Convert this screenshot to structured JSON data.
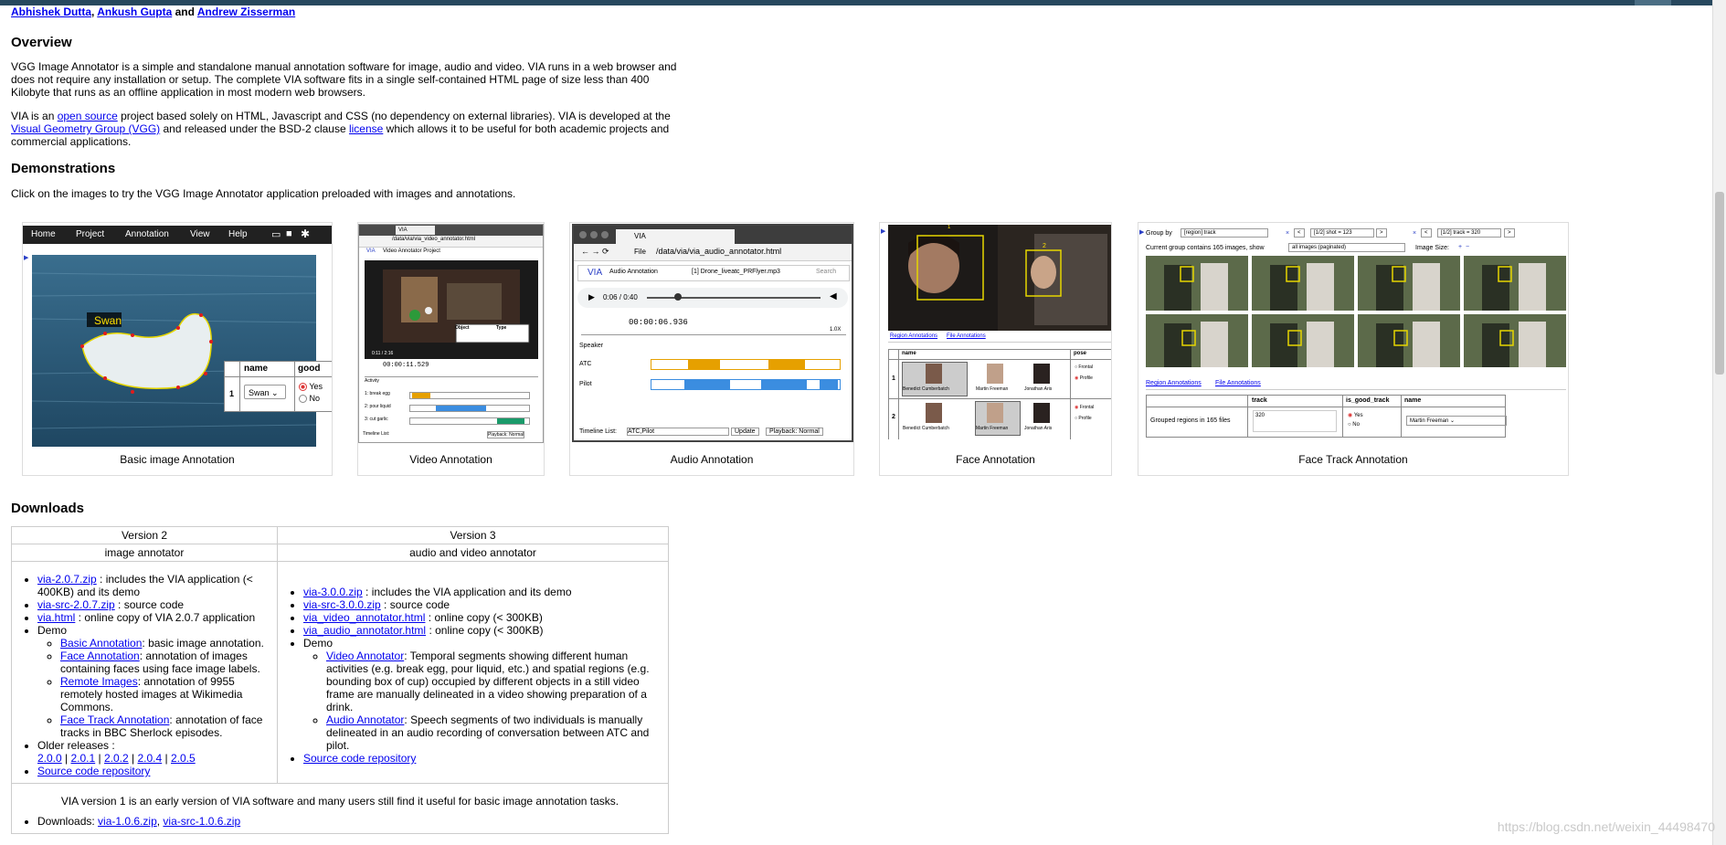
{
  "authors": {
    "a1": "Abhishek Dutta",
    "sep1": ", ",
    "a2": "Ankush Gupta",
    "sep2": " and ",
    "a3": "Andrew Zisserman"
  },
  "overview": {
    "heading": "Overview",
    "p1": "VGG Image Annotator is a simple and standalone manual annotation software for image, audio and video. VIA runs in a web browser and does not require any installation or setup. The complete VIA software fits in a single self-contained HTML page of size less than 400 Kilobyte that runs as an offline application in most modern web browsers.",
    "p2_a": "VIA is an ",
    "p2_link1": "open source",
    "p2_b": " project based solely on HTML, Javascript and CSS (no dependency on external libraries). VIA is developed at the ",
    "p2_link2": "Visual Geometry Group (VGG)",
    "p2_c": " and released under the BSD-2 clause ",
    "p2_link3": "license",
    "p2_d": " which allows it to be useful for both academic projects and commercial applications."
  },
  "demonstrations": {
    "heading": "Demonstrations",
    "intro": "Click on the images to try the VGG Image Annotator application preloaded with images and annotations.",
    "items": [
      {
        "caption": "Basic image Annotation"
      },
      {
        "caption": "Video Annotation"
      },
      {
        "caption": "Audio Annotation"
      },
      {
        "caption": "Face Annotation"
      },
      {
        "caption": "Face Track Annotation"
      }
    ],
    "basic": {
      "menu": [
        "Home",
        "Project",
        "Annotation",
        "View",
        "Help"
      ],
      "label": "Swan",
      "col1": "name",
      "col2": "good",
      "row": "1",
      "select": "Swan",
      "yes": "Yes",
      "no": "No"
    },
    "video": {
      "tab": "VIA",
      "url": "/data/via/via_video_annotator.html",
      "title": "Video Annotator Project",
      "time": "0:11 / 2:16",
      "tc": "00:00:11.529",
      "rows": [
        "Activity",
        "1: break egg",
        "2: pour liquid",
        "3: cut garlic"
      ],
      "timeline": "Timeline List:",
      "playback": "Playback: Normal",
      "obj": "Object",
      "type": "Type"
    },
    "audio": {
      "tab": "VIA",
      "url": "/data/via/via_audio_annotator.html",
      "file": "File",
      "title": "Audio Annotation",
      "fname": "[1] Drone_liveatc_PRFlyer.mp3",
      "search": "Search",
      "time": "0:06 / 0:40",
      "tc": "00:00:06.936",
      "speed": "1.0X",
      "speaker": "Speaker",
      "atc": "ATC",
      "pilot": "Pilot",
      "tl_label": "Timeline List:",
      "tl_val": "ATC,Pilot",
      "update": "Update",
      "playback": "Playback: Normal"
    },
    "face": {
      "tab1": "Region Annotations",
      "tab2": "File Annotations",
      "col1": "name",
      "col2": "pose",
      "r1": "1",
      "r2": "2",
      "n1": "Benedict Cumberbatch",
      "n2": "Martin Freeman",
      "n3": "Jonathan Aris",
      "p1": "Frontal",
      "p2": "Profile",
      "box1": "1",
      "box2": "2"
    },
    "track": {
      "groupby": "Group by",
      "groupval": "[region] track",
      "shot": "[1/2] shot = 123",
      "track": "[1/2] track = 320",
      "info": "Current group contains 165 images, show",
      "show": "all images (paginated)",
      "imgsize": "Image Size:",
      "tab1": "Region Annotations",
      "tab2": "File Annotations",
      "h1": "track",
      "h2": "is_good_track",
      "h3": "name",
      "rowlabel": "Grouped regions in 165 files",
      "trackval": "320",
      "yes": "Yes",
      "no": "No",
      "nameval": "Martin Freeman"
    }
  },
  "downloads": {
    "heading": "Downloads",
    "v2": "Version 2",
    "v3": "Version 3",
    "v2sub": "image annotator",
    "v3sub": "audio and video annotator",
    "v2list": {
      "l1": "via-2.0.7.zip",
      "t1": " : includes the VIA application (< 400KB) and its demo",
      "l2": "via-src-2.0.7.zip",
      "t2": " : source code",
      "l3": "via.html",
      "t3": " : online copy of VIA 2.0.7 application",
      "demo": "Demo",
      "d1l": "Basic Annotation",
      "d1t": ": basic image annotation.",
      "d2l": "Face Annotation",
      "d2t": ": annotation of images containing faces using face image labels.",
      "d3l": "Remote Images",
      "d3t": ": annotation of 9955 remotely hosted images at Wikimedia Commons.",
      "d4l": "Face Track Annotation",
      "d4t": ": annotation of face tracks in BBC Sherlock episodes.",
      "older": "Older releases :",
      "r1": "2.0.0",
      "r2": "2.0.1",
      "r3": "2.0.2",
      "r4": "2.0.4",
      "r5": "2.0.5",
      "rsep": " | ",
      "src": "Source code repository"
    },
    "v3list": {
      "l1": "via-3.0.0.zip",
      "t1": " : includes the VIA application and its demo",
      "l2": "via-src-3.0.0.zip",
      "t2": " : source code",
      "l3": "via_video_annotator.html",
      "t3": " : online copy (< 300KB)",
      "l4": "via_audio_annotator.html",
      "t4": " : online copy (< 300KB)",
      "demo": "Demo",
      "d1l": "Video Annotator",
      "d1t": ": Temporal segments showing different human activities (e.g. break egg, pour liquid, etc.) and spatial regions (e.g. bounding box of cup) occupied by different objects in a still video frame are manually delineated in a video showing preparation of a drink.",
      "d2l": "Audio Annotator",
      "d2t": ": Speech segments of two individuals is manually delineated in an audio recording of conversation between ATC and pilot.",
      "src": "Source code repository"
    },
    "v1text": "VIA version 1 is an early version of VIA software and many users still find it useful for basic image annotation tasks.",
    "v1dl": "Downloads: ",
    "v1l1": "via-1.0.6.zip",
    "v1sep": ", ",
    "v1l2": "via-src-1.0.6.zip"
  },
  "watermark": "https://blog.csdn.net/weixin_44498470"
}
